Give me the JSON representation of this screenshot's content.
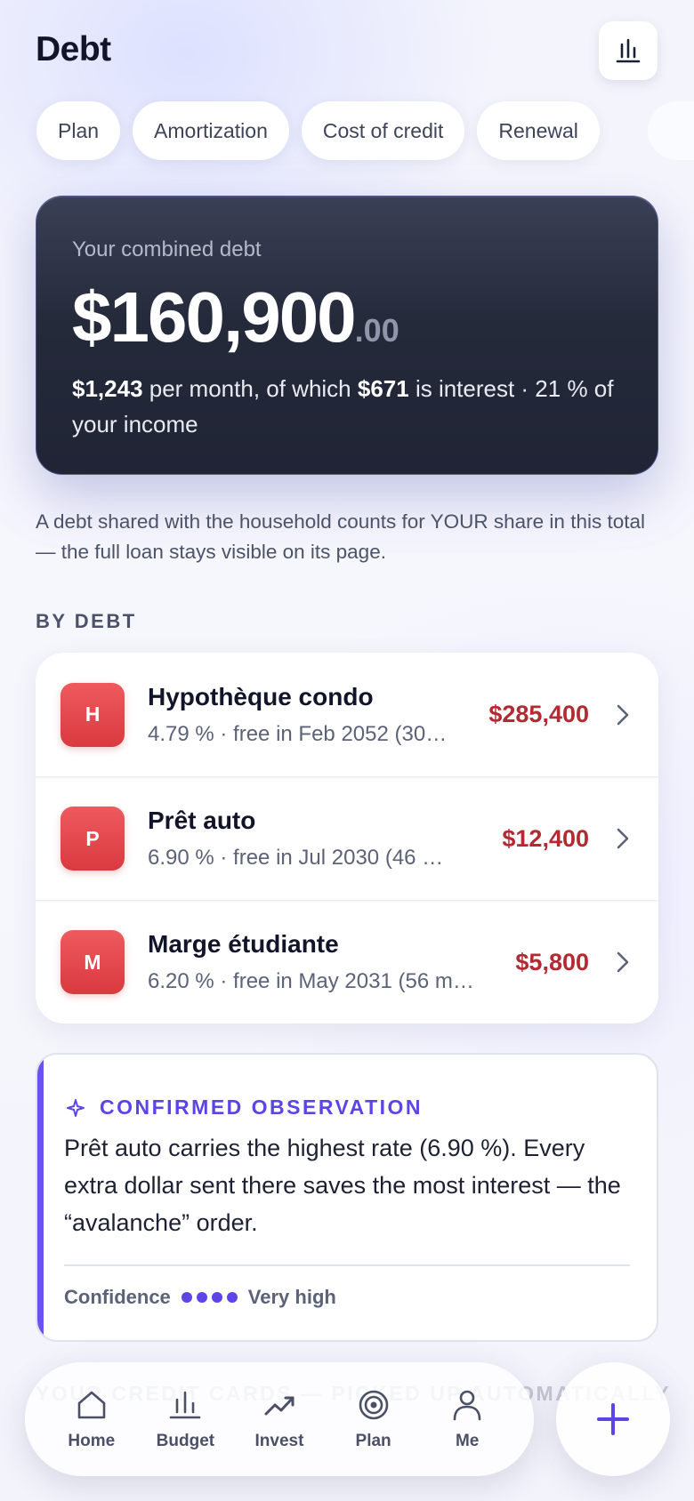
{
  "header": {
    "title": "Debt"
  },
  "tabs": [
    "Plan",
    "Amortization",
    "Cost of credit",
    "Renewal"
  ],
  "summary": {
    "label": "Your combined debt",
    "amount_main": "$160,900",
    "amount_cents": ".00",
    "monthly": "$1,243",
    "t1": " per month, of which ",
    "interest": "$671",
    "t2": " is interest · 21 % of your income"
  },
  "note": "A debt shared with the household counts for YOUR share in this total — the full loan stays visible on its page.",
  "section_label": "BY DEBT",
  "debts": [
    {
      "initial": "H",
      "name": "Hypothèque condo",
      "detail": "4.79 % · free in Feb 2052 (30…",
      "amount": "$285,400"
    },
    {
      "initial": "P",
      "name": "Prêt auto",
      "detail": "6.90 % · free in Jul 2030 (46 …",
      "amount": "$12,400"
    },
    {
      "initial": "M",
      "name": "Marge étudiante",
      "detail": "6.20 % · free in May 2031 (56 m…",
      "amount": "$5,800"
    }
  ],
  "observation": {
    "title": "CONFIRMED OBSERVATION",
    "text": "Prêt auto carries the highest rate (6.90 %). Every extra dollar sent there saves the most interest — the “avalanche” order.",
    "confidence_label": "Confidence",
    "confidence_level": 4,
    "confidence_value": "Very high"
  },
  "faded_section": "YOUR CREDIT CARDS — PICKED UP AUTOMATICALLY",
  "nav": [
    {
      "label": "Home",
      "icon": "home-icon"
    },
    {
      "label": "Budget",
      "icon": "bar-chart-icon"
    },
    {
      "label": "Invest",
      "icon": "trend-icon"
    },
    {
      "label": "Plan",
      "icon": "target-icon"
    },
    {
      "label": "Me",
      "icon": "person-icon"
    }
  ],
  "colors": {
    "accent": "#5b45e6",
    "debt_amount": "#b32a32",
    "badge": "#e04a50"
  }
}
